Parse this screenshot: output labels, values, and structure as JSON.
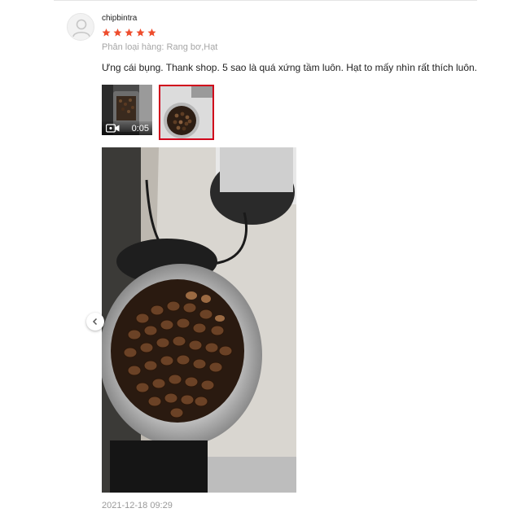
{
  "review": {
    "username": "chipbintra",
    "rating": 5,
    "variant": "Phân loại hàng: Rang bơ,Hạt",
    "comment": "Ưng cái bụng. Thank shop. 5 sao là quá xứng tầm luôn. Hạt to mấy nhìn rất thích luôn.",
    "video_duration": "0:05",
    "timestamp": "2021-12-18 09:29"
  },
  "icons": {
    "avatar": "user-placeholder-icon",
    "star": "star-icon",
    "video": "video-camera-icon",
    "prev": "chevron-left-icon"
  },
  "colors": {
    "star": "#ee4d2d",
    "selected_border": "#d0011b",
    "variant_text": "#a6a6a6",
    "timestamp_text": "#999999"
  }
}
